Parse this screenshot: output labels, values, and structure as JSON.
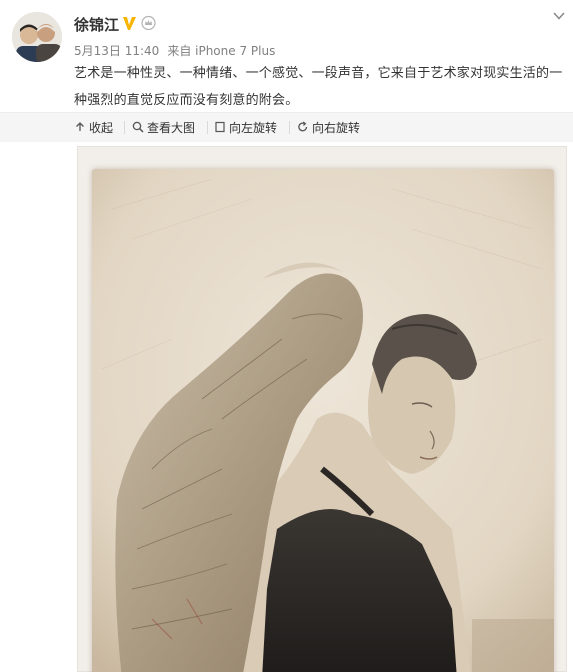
{
  "post": {
    "author": "徐锦江",
    "date": "5月13日 11:40",
    "source": "来自 iPhone 7 Plus",
    "text": "艺术是一种性灵、一种情绪、一个感觉、一段声音，它来自于艺术家对现实生活的一种强烈的直觉反应而没有刻意的附会。",
    "icons": {
      "verified": "verified-v-icon",
      "vip": "vip-crown-icon",
      "menu": "chevron-down-icon"
    }
  },
  "actions": {
    "collapse": "收起",
    "view_large": "查看大图",
    "rotate_left": "向左旋转",
    "rotate_right": "向右旋转"
  },
  "colors": {
    "verified": "#f7b500",
    "text": "#333333",
    "meta": "#808080",
    "sepia_bg": "#e6dccb"
  }
}
